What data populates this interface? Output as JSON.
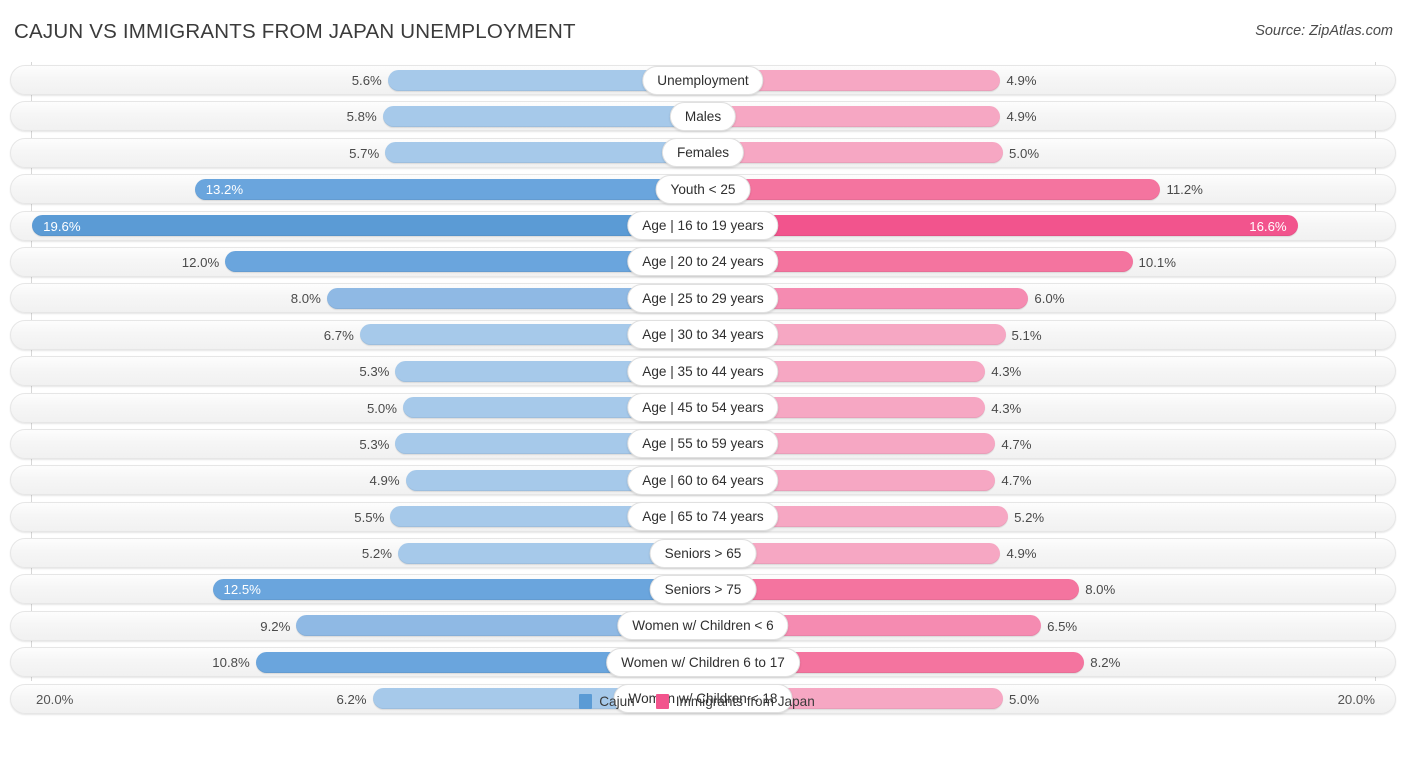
{
  "header": {
    "title": "CAJUN VS IMMIGRANTS FROM JAPAN UNEMPLOYMENT",
    "source": "Source: ZipAtlas.com"
  },
  "axis": {
    "left_label": "20.0%",
    "right_label": "20.0%",
    "max": 20.0
  },
  "legend": {
    "items": [
      {
        "label": "Cajun",
        "color": "#5b9bd5"
      },
      {
        "label": "Immigrants from Japan",
        "color": "#f2548d"
      }
    ]
  },
  "colors": {
    "blue_light": "#a6c9ea",
    "blue_mid": "#8fb9e4",
    "blue_strong": "#6aa5dd",
    "blue_max": "#5b9bd5",
    "pink_light": "#f6a7c3",
    "pink_mid": "#f58bb1",
    "pink_strong": "#f4749f",
    "pink_max": "#f2548d",
    "track": "#f4f4f4",
    "gridline": "#d7d7d7"
  },
  "chart_data": {
    "type": "bar",
    "orientation": "horizontal-diverging",
    "title": "CAJUN VS IMMIGRANTS FROM JAPAN UNEMPLOYMENT",
    "xlabel": "",
    "ylabel": "",
    "xlim": [
      20.0,
      20.0
    ],
    "grid": true,
    "legend_position": "bottom-center",
    "categories": [
      "Unemployment",
      "Males",
      "Females",
      "Youth < 25",
      "Age | 16 to 19 years",
      "Age | 20 to 24 years",
      "Age | 25 to 29 years",
      "Age | 30 to 34 years",
      "Age | 35 to 44 years",
      "Age | 45 to 54 years",
      "Age | 55 to 59 years",
      "Age | 60 to 64 years",
      "Age | 65 to 74 years",
      "Seniors > 65",
      "Seniors > 75",
      "Women w/ Children < 6",
      "Women w/ Children 6 to 17",
      "Women w/ Children < 18"
    ],
    "series": [
      {
        "name": "Cajun",
        "values": [
          5.6,
          5.8,
          5.7,
          13.2,
          19.6,
          12.0,
          8.0,
          6.7,
          5.3,
          5.0,
          5.3,
          4.9,
          5.5,
          5.2,
          12.5,
          9.2,
          10.8,
          6.2
        ],
        "labels": [
          "5.6%",
          "5.8%",
          "5.7%",
          "13.2%",
          "19.6%",
          "12.0%",
          "8.0%",
          "6.7%",
          "5.3%",
          "5.0%",
          "5.3%",
          "4.9%",
          "5.5%",
          "5.2%",
          "12.5%",
          "9.2%",
          "10.8%",
          "6.2%"
        ]
      },
      {
        "name": "Immigrants from Japan",
        "values": [
          4.9,
          4.9,
          5.0,
          11.2,
          16.6,
          10.1,
          6.0,
          5.1,
          4.3,
          4.3,
          4.7,
          4.7,
          5.2,
          4.9,
          8.0,
          6.5,
          8.2,
          5.0
        ],
        "labels": [
          "4.9%",
          "4.9%",
          "5.0%",
          "11.2%",
          "16.6%",
          "10.1%",
          "6.0%",
          "5.1%",
          "4.3%",
          "4.3%",
          "4.7%",
          "4.7%",
          "5.2%",
          "4.9%",
          "8.0%",
          "6.5%",
          "8.2%",
          "5.0%"
        ]
      }
    ]
  },
  "rows": [
    {
      "label": "Unemployment",
      "left_value": 5.6,
      "left_label": "5.6%",
      "right_value": 4.9,
      "right_label": "4.9%",
      "emphasis": "none",
      "left_inside": false,
      "right_inside": false
    },
    {
      "label": "Males",
      "left_value": 5.8,
      "left_label": "5.8%",
      "right_value": 4.9,
      "right_label": "4.9%",
      "emphasis": "none",
      "left_inside": false,
      "right_inside": false
    },
    {
      "label": "Females",
      "left_value": 5.7,
      "left_label": "5.7%",
      "right_value": 5.0,
      "right_label": "5.0%",
      "emphasis": "none",
      "left_inside": false,
      "right_inside": false
    },
    {
      "label": "Youth < 25",
      "left_value": 13.2,
      "left_label": "13.2%",
      "right_value": 11.2,
      "right_label": "11.2%",
      "emphasis": "hl1",
      "left_inside": true,
      "right_inside": false
    },
    {
      "label": "Age | 16 to 19 years",
      "left_value": 19.6,
      "left_label": "19.6%",
      "right_value": 16.6,
      "right_label": "16.6%",
      "emphasis": "hl2",
      "left_inside": true,
      "right_inside": true
    },
    {
      "label": "Age | 20 to 24 years",
      "left_value": 12.0,
      "left_label": "12.0%",
      "right_value": 10.1,
      "right_label": "10.1%",
      "emphasis": "hl1",
      "left_inside": false,
      "right_inside": false
    },
    {
      "label": "Age | 25 to 29 years",
      "left_value": 8.0,
      "left_label": "8.0%",
      "right_value": 6.0,
      "right_label": "6.0%",
      "emphasis": "mid",
      "left_inside": false,
      "right_inside": false
    },
    {
      "label": "Age | 30 to 34 years",
      "left_value": 6.7,
      "left_label": "6.7%",
      "right_value": 5.1,
      "right_label": "5.1%",
      "emphasis": "none",
      "left_inside": false,
      "right_inside": false
    },
    {
      "label": "Age | 35 to 44 years",
      "left_value": 5.3,
      "left_label": "5.3%",
      "right_value": 4.3,
      "right_label": "4.3%",
      "emphasis": "none",
      "left_inside": false,
      "right_inside": false
    },
    {
      "label": "Age | 45 to 54 years",
      "left_value": 5.0,
      "left_label": "5.0%",
      "right_value": 4.3,
      "right_label": "4.3%",
      "emphasis": "none",
      "left_inside": false,
      "right_inside": false
    },
    {
      "label": "Age | 55 to 59 years",
      "left_value": 5.3,
      "left_label": "5.3%",
      "right_value": 4.7,
      "right_label": "4.7%",
      "emphasis": "none",
      "left_inside": false,
      "right_inside": false
    },
    {
      "label": "Age | 60 to 64 years",
      "left_value": 4.9,
      "left_label": "4.9%",
      "right_value": 4.7,
      "right_label": "4.7%",
      "emphasis": "none",
      "left_inside": false,
      "right_inside": false
    },
    {
      "label": "Age | 65 to 74 years",
      "left_value": 5.5,
      "left_label": "5.5%",
      "right_value": 5.2,
      "right_label": "5.2%",
      "emphasis": "none",
      "left_inside": false,
      "right_inside": false
    },
    {
      "label": "Seniors > 65",
      "left_value": 5.2,
      "left_label": "5.2%",
      "right_value": 4.9,
      "right_label": "4.9%",
      "emphasis": "none",
      "left_inside": false,
      "right_inside": false
    },
    {
      "label": "Seniors > 75",
      "left_value": 12.5,
      "left_label": "12.5%",
      "right_value": 8.0,
      "right_label": "8.0%",
      "emphasis": "hl1",
      "left_inside": true,
      "right_inside": false
    },
    {
      "label": "Women w/ Children < 6",
      "left_value": 9.2,
      "left_label": "9.2%",
      "right_value": 6.5,
      "right_label": "6.5%",
      "emphasis": "mid",
      "left_inside": false,
      "right_inside": false
    },
    {
      "label": "Women w/ Children 6 to 17",
      "left_value": 10.8,
      "left_label": "10.8%",
      "right_value": 8.2,
      "right_label": "8.2%",
      "emphasis": "hl1",
      "left_inside": false,
      "right_inside": false
    },
    {
      "label": "Women w/ Children < 18",
      "left_value": 6.2,
      "left_label": "6.2%",
      "right_value": 5.0,
      "right_label": "5.0%",
      "emphasis": "none",
      "left_inside": false,
      "right_inside": false
    }
  ]
}
